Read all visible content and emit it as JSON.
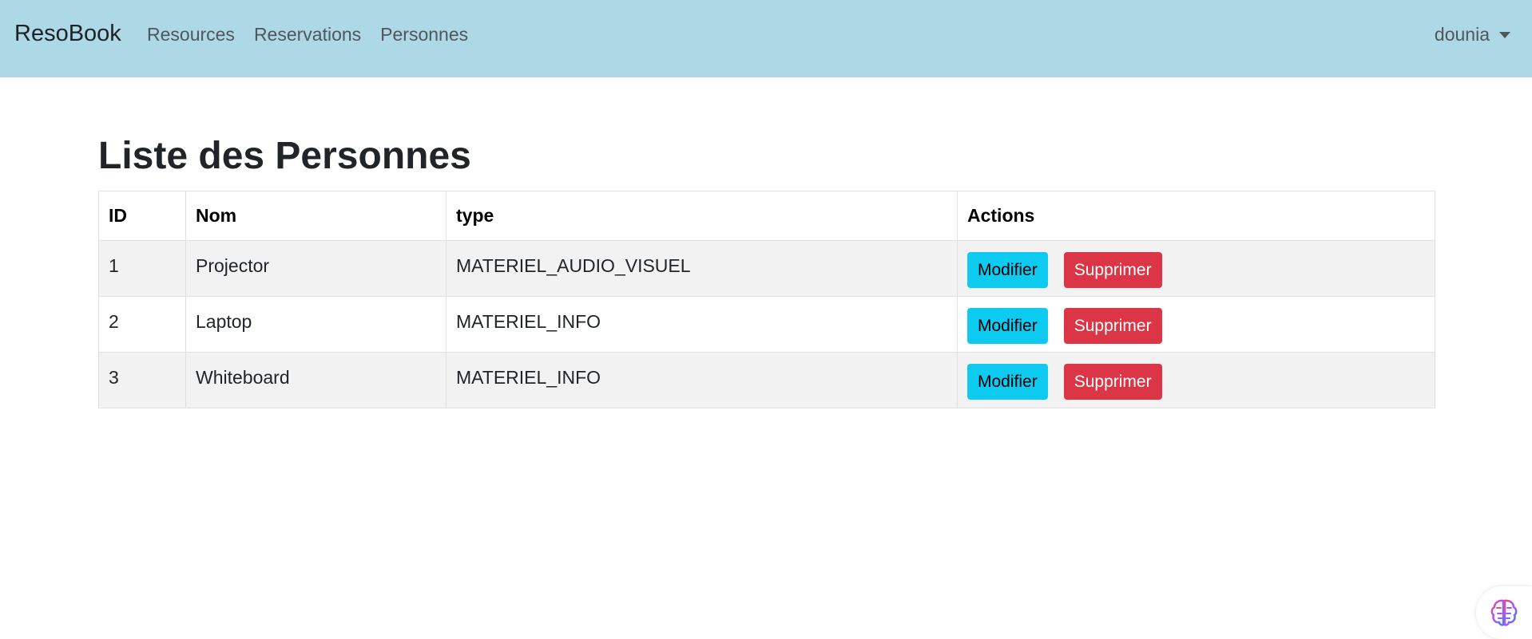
{
  "navbar": {
    "brand": "ResoBook",
    "links": [
      "Resources",
      "Reservations",
      "Personnes"
    ],
    "user": "dounia",
    "background": "#add8e6"
  },
  "main": {
    "title": "Liste des Personnes",
    "table": {
      "headers": [
        "ID",
        "Nom",
        "type",
        "Actions"
      ],
      "rows": [
        {
          "id": "1",
          "nom": "Projector",
          "type": "MATERIEL_AUDIO_VISUEL"
        },
        {
          "id": "2",
          "nom": "Laptop",
          "type": "MATERIEL_INFO"
        },
        {
          "id": "3",
          "nom": "Whiteboard",
          "type": "MATERIEL_INFO"
        }
      ],
      "edit_label": "Modifier",
      "delete_label": "Supprimer"
    }
  },
  "colors": {
    "edit_button": "#0dcaf0",
    "delete_button": "#dc3545",
    "row_stripe": "#f2f2f2"
  },
  "icons": {
    "assistant": "brain-icon",
    "user_dropdown": "caret-down-icon"
  }
}
